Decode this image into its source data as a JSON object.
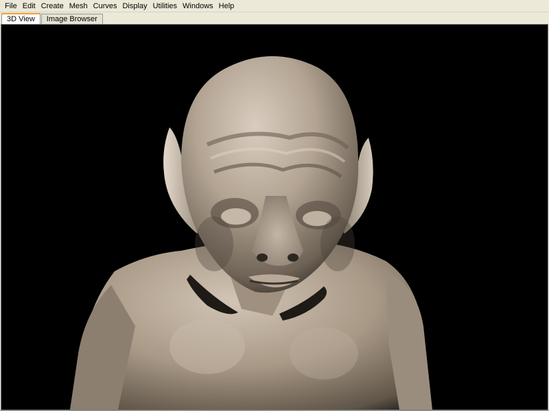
{
  "menubar": {
    "items": [
      "File",
      "Edit",
      "Create",
      "Mesh",
      "Curves",
      "Display",
      "Utilities",
      "Windows",
      "Help"
    ]
  },
  "tabs": [
    {
      "label": "3D View",
      "active": true
    },
    {
      "label": "Image Browser",
      "active": false
    }
  ],
  "viewport": {
    "background_color": "#000000",
    "model_color": "#a8998a",
    "subject": "sculpted-creature-bust"
  }
}
